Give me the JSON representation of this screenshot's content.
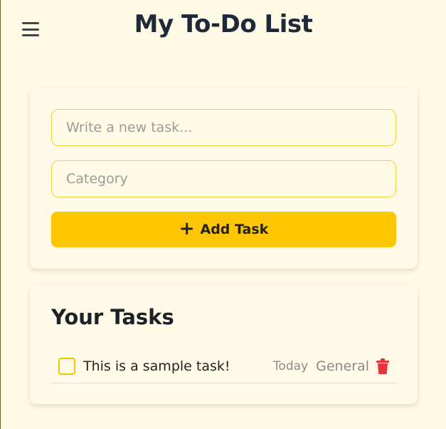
{
  "header": {
    "title": "My To-Do List",
    "menu_icon": "hamburger-menu-icon"
  },
  "add_form": {
    "task_placeholder": "Write a new task...",
    "task_value": "",
    "category_placeholder": "Category",
    "category_value": "",
    "add_label": "Add Task",
    "add_icon": "plus-icon",
    "accent_color": "#fdc600"
  },
  "task_list": {
    "title": "Your Tasks",
    "tasks": [
      {
        "text": "This is a sample task!",
        "date": "Today",
        "category": "General",
        "completed": false,
        "delete_icon": "trash-icon"
      }
    ]
  },
  "colors": {
    "background": "#fffae6",
    "accent": "#fdc600",
    "delete": "#e8323a"
  }
}
